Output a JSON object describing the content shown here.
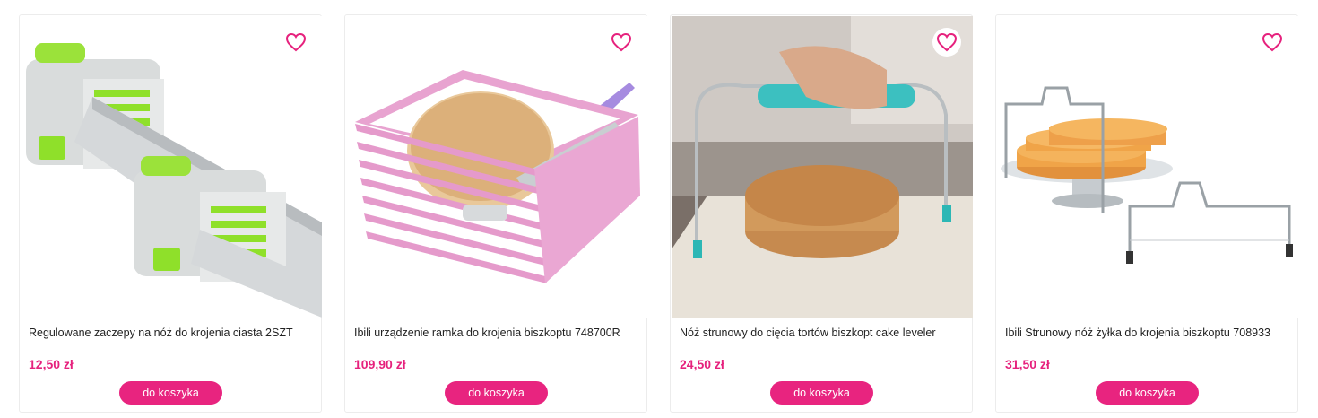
{
  "accent_color": "#e8247f",
  "products": [
    {
      "name": "Regulowane zaczepy na nóż do krojenia ciasta 2SZT",
      "price": "12,50 zł",
      "button_label": "do koszyka",
      "image_icon": "cake-slicer-clips-image"
    },
    {
      "name": "Ibili urządzenie ramka do krojenia biszkoptu 748700R",
      "price": "109,90 zł",
      "button_label": "do koszyka",
      "image_icon": "cake-cutting-frame-image"
    },
    {
      "name": "Nóż strunowy do cięcia tortów biszkopt cake leveler",
      "price": "24,50 zł",
      "button_label": "do koszyka",
      "image_icon": "cake-leveler-image"
    },
    {
      "name": "Ibili Strunowy nóż żyłka do krojenia biszkoptu 708933",
      "price": "31,50 zł",
      "button_label": "do koszyka",
      "image_icon": "wire-cake-cutter-image"
    }
  ]
}
